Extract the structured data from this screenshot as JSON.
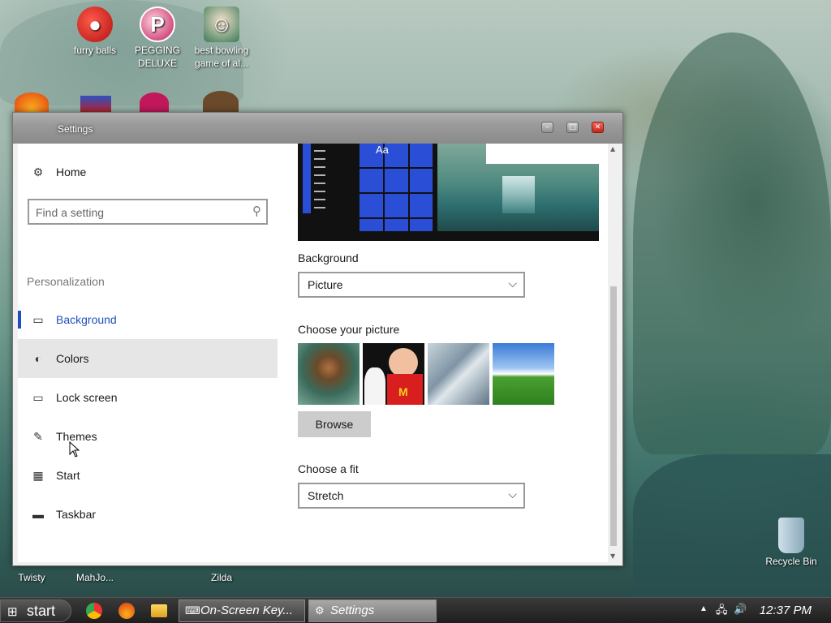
{
  "desktop": {
    "icons": [
      {
        "label": "furry balls",
        "icon": "furry-balls-icon"
      },
      {
        "label": "PEGGING DELUXE",
        "icon": "pegging-deluxe-icon"
      },
      {
        "label": "best bowling game of al...",
        "icon": "bowling-game-icon"
      },
      {
        "label": "Twisty",
        "icon": "twisty-icon"
      },
      {
        "label": "MahJo...",
        "icon": "mahjong-icon"
      },
      {
        "label": "Zilda",
        "icon": "zilda-icon"
      },
      {
        "label": "Recycle Bin",
        "icon": "recycle-bin-icon"
      }
    ]
  },
  "window": {
    "title": "Settings",
    "controls": {
      "minimize": "–",
      "maximize": "□",
      "close": "✕"
    }
  },
  "sidebar": {
    "home_label": "Home",
    "search_placeholder": "Find a setting",
    "section_label": "Personalization",
    "items": [
      {
        "label": "Background",
        "icon": "image-icon",
        "selected": true
      },
      {
        "label": "Colors",
        "icon": "palette-icon",
        "hovered": true
      },
      {
        "label": "Lock screen",
        "icon": "lock-screen-icon"
      },
      {
        "label": "Themes",
        "icon": "themes-icon"
      },
      {
        "label": "Start",
        "icon": "start-menu-icon"
      },
      {
        "label": "Taskbar",
        "icon": "taskbar-icon"
      }
    ]
  },
  "content": {
    "preview_sample_text": "Aa",
    "background_label": "Background",
    "background_value": "Picture",
    "choose_picture_label": "Choose your picture",
    "browse_label": "Browse",
    "choose_fit_label": "Choose a fit",
    "fit_value": "Stretch"
  },
  "taskbar": {
    "start_label": "start",
    "tasks": [
      {
        "label": "On-Screen Key...",
        "icon": "keyboard-icon"
      },
      {
        "label": "Settings",
        "icon": "gear-icon"
      }
    ],
    "clock": "12:37 PM"
  }
}
